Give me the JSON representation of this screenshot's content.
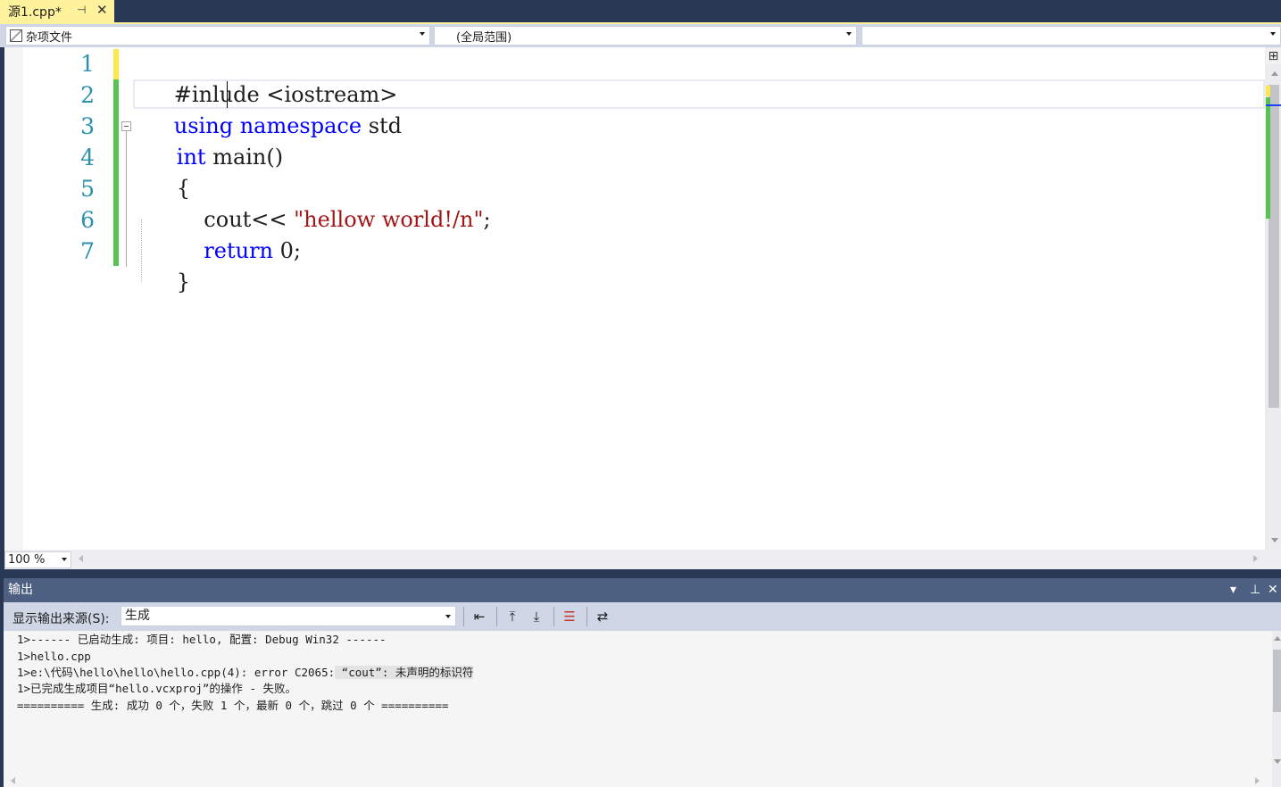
{
  "tab": {
    "title": "源1.cpp*",
    "pin_icon": "pin-icon",
    "close_icon": "close-icon"
  },
  "navbar": {
    "project_combo": "杂项文件",
    "scope_combo": "(全局范围)",
    "member_combo": ""
  },
  "editor": {
    "line_numbers": [
      "1",
      "2",
      "3",
      "4",
      "5",
      "6",
      "7"
    ],
    "lines": [
      {
        "segments": [
          {
            "text": "#inlude <iostream>",
            "kind": "plain"
          }
        ]
      },
      {
        "segments": [
          {
            "text": "using",
            "kind": "keyword"
          },
          {
            "text": " ",
            "kind": "plain"
          },
          {
            "text": "namespace",
            "kind": "keyword"
          },
          {
            "text": " std",
            "kind": "plain"
          }
        ]
      },
      {
        "segments": [
          {
            "text": "int",
            "kind": "keyword"
          },
          {
            "text": " main()",
            "kind": "plain"
          }
        ]
      },
      {
        "segments": [
          {
            "text": "{",
            "kind": "plain"
          }
        ]
      },
      {
        "segments": [
          {
            "text": "    cout<< ",
            "kind": "plain"
          },
          {
            "text": "\"hellow world!/n\"",
            "kind": "string"
          },
          {
            "text": ";",
            "kind": "plain"
          }
        ]
      },
      {
        "segments": [
          {
            "text": "    ",
            "kind": "plain"
          },
          {
            "text": "return",
            "kind": "keyword"
          },
          {
            "text": " 0;",
            "kind": "plain"
          }
        ]
      },
      {
        "segments": [
          {
            "text": "}",
            "kind": "plain"
          }
        ]
      }
    ],
    "zoom": "100 %",
    "colors": {
      "keyword": "#0000ff",
      "string": "#a31515",
      "line_number": "#2b91af",
      "changed_saved": "#57c353",
      "changed_unsaved": "#fde84a"
    }
  },
  "output": {
    "title": "输出",
    "source_label": "显示输出来源(S):",
    "source_value": "生成",
    "lines": [
      "1>------ 已启动生成: 项目: hello, 配置: Debug Win32 ------",
      "1>hello.cpp",
      "1>e:\\代码\\hello\\hello\\hello.cpp(4): error C2065:",
      "1>已完成生成项目“hello.vcxproj”的操作 - 失败。",
      "========== 生成: 成功 0 个，失败 1 个，最新 0 个，跳过 0 个 =========="
    ],
    "error_highlight": " “cout”: 未声明的标识符"
  }
}
